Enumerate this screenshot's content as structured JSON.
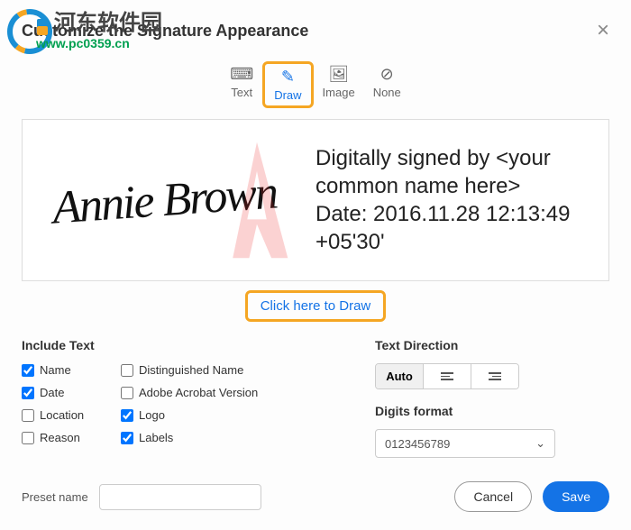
{
  "watermark": {
    "site_name": "河东软件园",
    "url": "www.pc0359.cn"
  },
  "dialog": {
    "title": "Customize the Signature Appearance",
    "tabs": {
      "text": "Text",
      "draw": "Draw",
      "image": "Image",
      "none": "None"
    },
    "preview": {
      "signature_name": "Annie Brown",
      "info_text": "Digitally signed by <your common name here>\nDate: 2016.11.28 12:13:49 +05'30'"
    },
    "draw_link": "Click here to Draw",
    "include_text": {
      "title": "Include Text",
      "name": "Name",
      "distinguished_name": "Distinguished Name",
      "date": "Date",
      "acrobat_version": "Adobe Acrobat Version",
      "location": "Location",
      "logo": "Logo",
      "reason": "Reason",
      "labels": "Labels"
    },
    "text_direction": {
      "title": "Text Direction",
      "auto": "Auto"
    },
    "digits_format": {
      "title": "Digits format",
      "value": "0123456789"
    },
    "preset": {
      "label": "Preset name",
      "value": ""
    },
    "buttons": {
      "cancel": "Cancel",
      "save": "Save"
    }
  }
}
